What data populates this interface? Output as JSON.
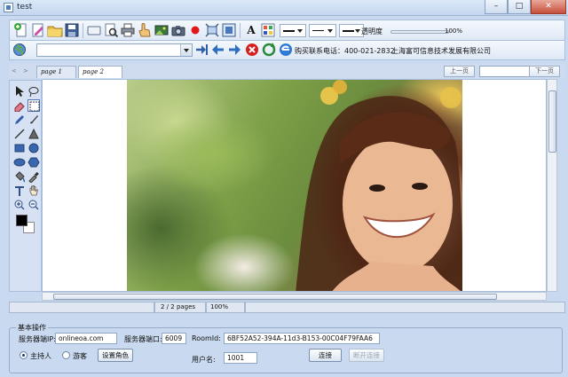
{
  "window": {
    "title": "test",
    "min_label": "–",
    "max_label": "□",
    "close_label": "✕"
  },
  "toolbar": {
    "opacity_label": "透明度",
    "opacity_value": "100%",
    "purchase_text": "购买联系电话：400-021-2832",
    "company_text": "上海富可信息技术发展有限公司",
    "font_glyph": "A",
    "url_value": ""
  },
  "tabs": {
    "items": [
      {
        "label": "page 1"
      },
      {
        "label": "page 2"
      }
    ],
    "prev_label": "上一页",
    "next_label": "下一页",
    "page_select_value": ""
  },
  "status": {
    "pages": "2 / 2 pages",
    "zoom": "100%"
  },
  "basic_ops": {
    "title": "基本操作",
    "server_ip_label": "服务器端IP:",
    "server_ip_value": "onlineoa.com",
    "server_port_label": "服务器端口:",
    "server_port_value": "6009",
    "roomid_label": "RoomId:",
    "roomid_value": "6BF52A52-394A-11d3-B153-00C04F79FAA6",
    "host_label": "主持人",
    "guest_label": "游客",
    "set_role_label": "设置角色",
    "username_label": "用户名:",
    "username_value": "1001",
    "connect_label": "连接",
    "disconnect_label": "断开连接",
    "selected_role": "host"
  }
}
